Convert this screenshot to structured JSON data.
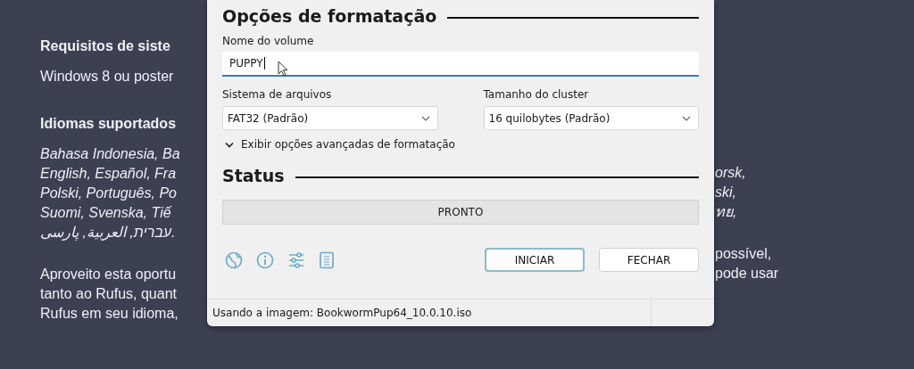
{
  "background_page": {
    "left_lines": [
      {
        "kind": "heading",
        "text": "Requisitos de siste"
      },
      {
        "kind": "body",
        "text": "Windows 8 ou poster"
      },
      {
        "kind": "heading",
        "text": "Idiomas suportados"
      },
      {
        "kind": "languages",
        "text": "Bahasa Indonesia, Ba"
      },
      {
        "kind": "languages",
        "text": "English, Español, Fra"
      },
      {
        "kind": "languages",
        "text": "Polski, Português, Po"
      },
      {
        "kind": "languages",
        "text": "Suomi, Svenska, Tiế"
      },
      {
        "kind": "languages",
        "text": "עברית, العربية, پارسی."
      },
      {
        "kind": "body",
        "text": "Aproveito esta oportu"
      },
      {
        "kind": "body",
        "text": "tanto ao Rufus, quant"
      },
      {
        "kind": "body",
        "text": "Rufus em seu idioma,"
      }
    ],
    "right_lines": [
      {
        "kind": "languages",
        "text": "orsk,"
      },
      {
        "kind": "languages",
        "text": "ski,"
      },
      {
        "kind": "languages",
        "text": "ทย,"
      },
      {
        "kind": "body",
        "text": "possível,"
      },
      {
        "kind": "body",
        "text": "pode usar"
      }
    ]
  },
  "dialog": {
    "section_title": "Opções de formatação",
    "volume_label": {
      "label": "Nome do volume",
      "value": "PUPPY"
    },
    "file_system": {
      "label": "Sistema de arquivos",
      "value": "FAT32 (Padrão)"
    },
    "cluster_size": {
      "label": "Tamanho do cluster",
      "value": "16 quilobytes (Padrão)"
    },
    "advanced": {
      "label": "Exibir opções avançadas de formatação",
      "expanded": false
    },
    "status_title": "Status",
    "progress": {
      "text": "PRONTO"
    },
    "buttons": [
      {
        "label": "INICIAR",
        "focused": true
      },
      {
        "label": "FECHAR",
        "focused": false
      }
    ],
    "status_bar": "Usando a imagem: BookwormPup64_10.0.10.iso"
  }
}
